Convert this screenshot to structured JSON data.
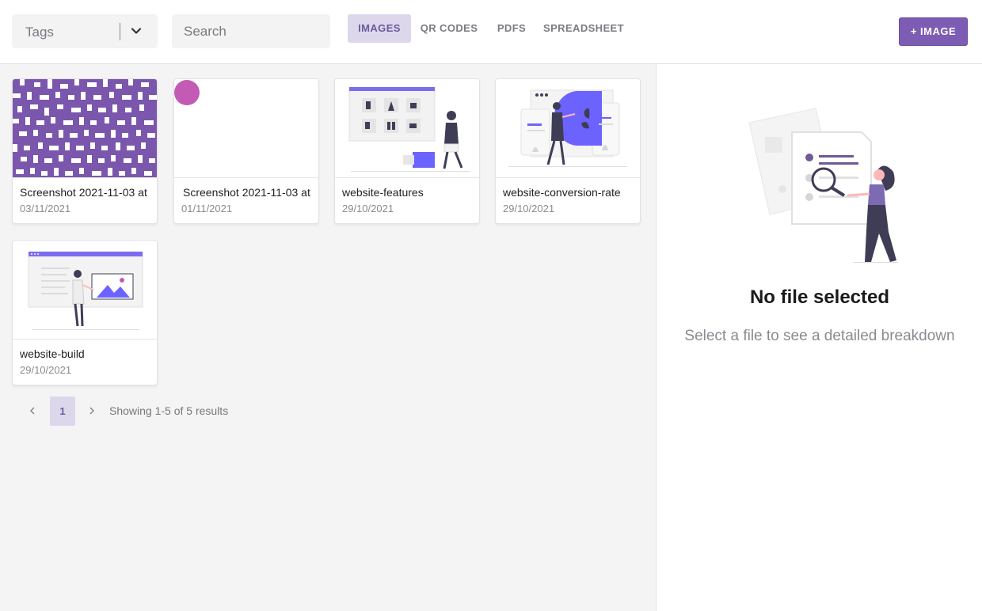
{
  "toolbar": {
    "tags_label": "Tags",
    "search_placeholder": "Search",
    "tabs": [
      {
        "label": "IMAGES",
        "active": true
      },
      {
        "label": "QR CODES",
        "active": false
      },
      {
        "label": "PDFS",
        "active": false
      },
      {
        "label": "SPREADSHEET",
        "active": false
      }
    ],
    "add_button_label": "+ IMAGE"
  },
  "files": [
    {
      "name": "Screenshot 2021-11-03 at",
      "date": "03/11/2021",
      "thumbnail": "qr-code-image"
    },
    {
      "name": "Screenshot 2021-11-03 at",
      "date": "01/11/2021",
      "thumbnail": "pink-dot-image"
    },
    {
      "name": "website-features",
      "date": "29/10/2021",
      "thumbnail": "website-features-illustration"
    },
    {
      "name": "website-conversion-rate",
      "date": "29/10/2021",
      "thumbnail": "website-conversion-illustration"
    },
    {
      "name": "website-build",
      "date": "29/10/2021",
      "thumbnail": "website-build-illustration"
    }
  ],
  "pagination": {
    "prev_icon": "chevron-left-icon",
    "current_page": "1",
    "next_icon": "chevron-right-icon",
    "summary": "Showing 1-5 of 5 results"
  },
  "detail": {
    "title": "No file selected",
    "subtitle": "Select a file to see a detailed breakdown"
  },
  "colors": {
    "accent": "#7d5cb3",
    "accent_light": "#ddd7ec",
    "panel_bg": "#f4f4f5"
  }
}
